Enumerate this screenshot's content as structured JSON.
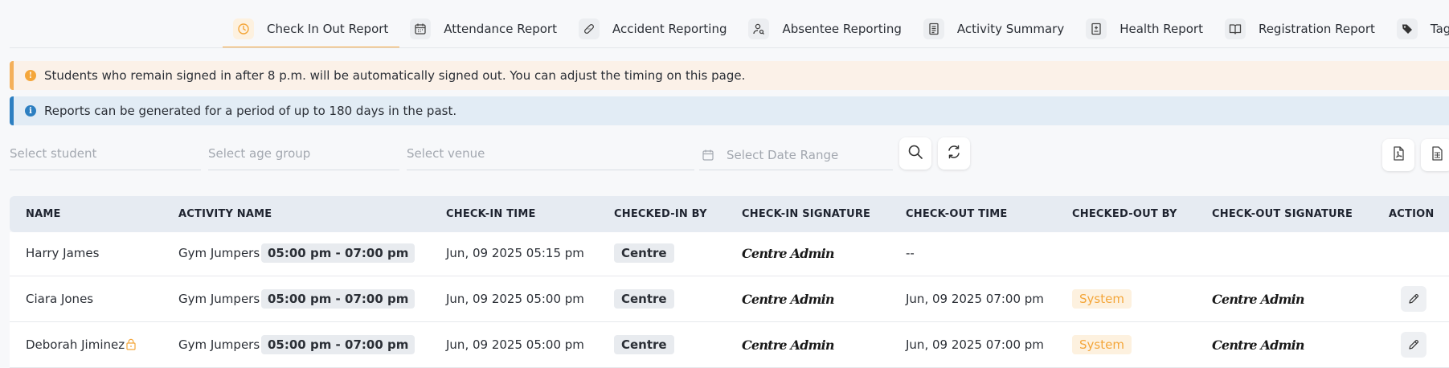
{
  "tabs": [
    {
      "label": "Check In Out Report",
      "icon": "clock-icon",
      "active": true
    },
    {
      "label": "Attendance Report",
      "icon": "calendar-icon"
    },
    {
      "label": "Accident Reporting",
      "icon": "bandage-icon"
    },
    {
      "label": "Absentee Reporting",
      "icon": "user-search-icon"
    },
    {
      "label": "Activity Summary",
      "icon": "list-doc-icon"
    },
    {
      "label": "Health Report",
      "icon": "medical-doc-icon"
    },
    {
      "label": "Registration Report",
      "icon": "book-icon"
    },
    {
      "label": "Tags",
      "icon": "tag-icon"
    }
  ],
  "alerts": {
    "warning": "Students who remain signed in after 8 p.m. will be automatically signed out. You can adjust the timing on this page.",
    "info": "Reports can be generated for a period of up to 180 days in the past."
  },
  "filters": {
    "student": "Select student",
    "age_group": "Select age group",
    "venue": "Select venue",
    "date_range": "Select Date Range"
  },
  "colors": {
    "accent": "#f4a63a",
    "info": "#2d7fc1",
    "header_bg": "#e6ebf2"
  },
  "table": {
    "headers": [
      "NAME",
      "ACTIVITY NAME",
      "CHECK-IN TIME",
      "CHECKED-IN BY",
      "CHECK-IN SIGNATURE",
      "CHECK-OUT TIME",
      "CHECKED-OUT BY",
      "CHECK-OUT SIGNATURE",
      "ACTION"
    ],
    "rows": [
      {
        "name": "Harry James",
        "activity": "Gym Jumpers",
        "slot": "05:00 pm - 07:00 pm",
        "checkin_time": "Jun, 09 2025 05:15 pm",
        "checkin_by": "Centre",
        "checkin_sig": "Centre Admin",
        "checkout_time": "--",
        "checkout_by": "",
        "checkout_sig": "",
        "editable": false
      },
      {
        "name": "Ciara Jones",
        "activity": "Gym Jumpers",
        "slot": "05:00 pm - 07:00 pm",
        "checkin_time": "Jun, 09 2025 05:00 pm",
        "checkin_by": "Centre",
        "checkin_sig": "Centre Admin",
        "checkout_time": "Jun, 09 2025 07:00 pm",
        "checkout_by": "System",
        "checkout_sig": "Centre Admin",
        "editable": true
      },
      {
        "name": "Deborah Jiminez",
        "activity": "Gym Jumpers",
        "slot": "05:00 pm - 07:00 pm",
        "checkin_time": "Jun, 09 2025 05:00 pm",
        "checkin_by": "Centre",
        "checkin_sig": "Centre Admin",
        "checkout_time": "Jun, 09 2025 07:00 pm",
        "checkout_by": "System",
        "checkout_sig": "Centre Admin",
        "editable": true,
        "locked": true
      }
    ]
  }
}
